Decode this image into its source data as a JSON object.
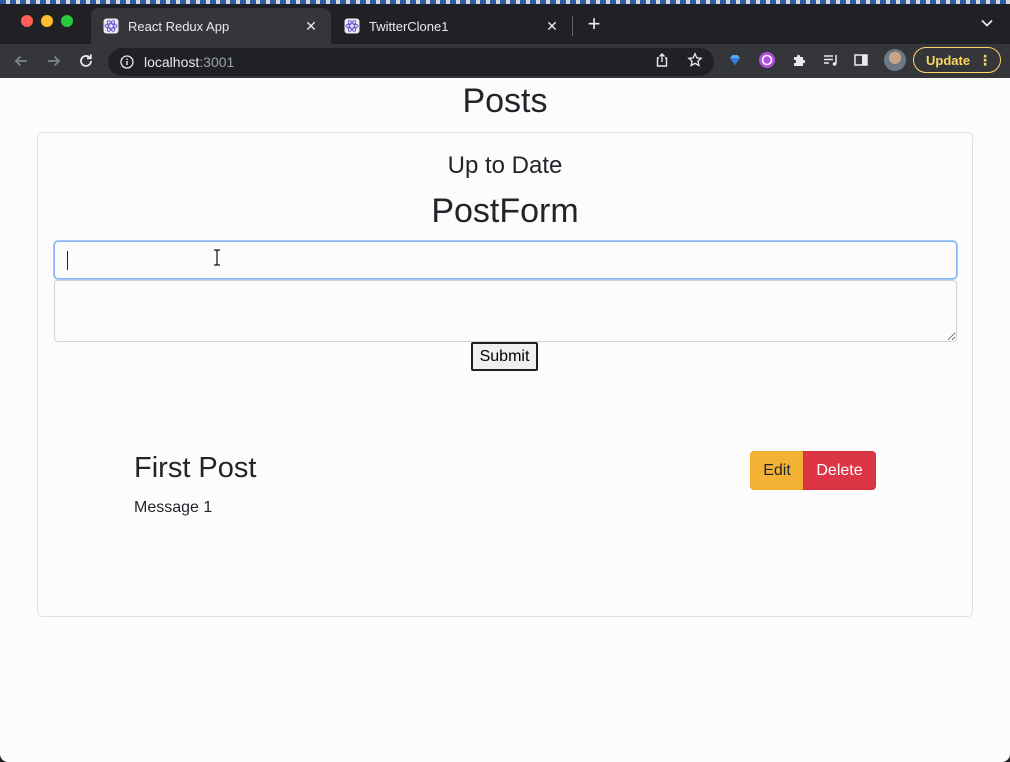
{
  "browser": {
    "tabs": [
      {
        "label": "React Redux App",
        "active": true
      },
      {
        "label": "TwitterClone1",
        "active": false
      }
    ],
    "address": {
      "host": "localhost",
      "port": ":3001"
    },
    "update_label": "Update",
    "colors": {
      "titlebar": "#202124",
      "toolbar": "#35363a",
      "update": "#fdd663"
    }
  },
  "page": {
    "title": "Posts",
    "card": {
      "subtitle": "Up to Date",
      "form_title": "PostForm",
      "title_input": {
        "value": "",
        "placeholder": ""
      },
      "body_input": {
        "value": "",
        "placeholder": ""
      },
      "submit_label": "Submit"
    },
    "posts": [
      {
        "title": "First Post",
        "body": "Message 1",
        "edit_label": "Edit",
        "delete_label": "Delete"
      }
    ],
    "colors": {
      "edit": "#f3b234",
      "delete": "#dc3545",
      "text": "#212529"
    }
  }
}
